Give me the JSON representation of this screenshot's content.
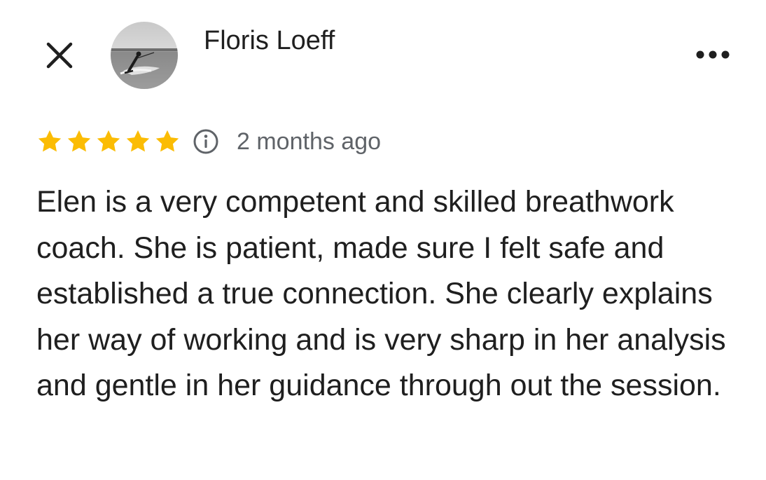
{
  "header": {
    "close_icon": "close-icon",
    "more_icon": "more-horizontal-icon"
  },
  "reviewer": {
    "name": "Floris Loeff",
    "avatar_icon": "avatar-photo-waterskier"
  },
  "review": {
    "rating": 5,
    "max_rating": 5,
    "star_color": "#fbbc04",
    "info_icon": "info-icon",
    "time_ago": "2 months ago",
    "text": "Elen  is a very competent and skilled breathwork coach. She is patient, made sure I felt safe and established a true connection. She clearly explains her way of working and is very sharp in her analysis and gentle in her guidance through out the session."
  }
}
